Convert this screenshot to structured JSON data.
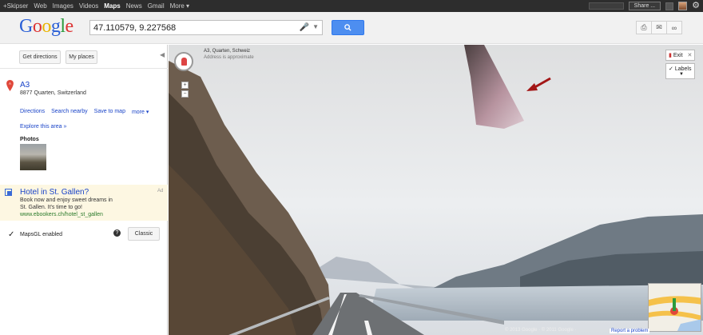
{
  "topbar": {
    "items": [
      "+Skipser",
      "Web",
      "Images",
      "Videos",
      "Maps",
      "News",
      "Gmail",
      "More ▾"
    ],
    "active": "Maps",
    "share_label": "Share ..."
  },
  "header": {
    "logo": "Google",
    "search_value": "47.110579, 9.227568",
    "search_button_icon": "search-icon",
    "tools": [
      "print-icon",
      "email-icon",
      "link-icon"
    ]
  },
  "left": {
    "get_directions": "Get directions",
    "my_places": "My places",
    "place": {
      "title": "A3",
      "address": "8877 Quarten, Switzerland",
      "links": [
        "Directions",
        "Search nearby",
        "Save to map",
        "more ▾"
      ],
      "explore": "Explore this area »",
      "photos_label": "Photos"
    },
    "ad": {
      "title": "Hotel in St. Gallen?",
      "line1": "Book now and enjoy sweet dreams in",
      "line2": "St. Gallen. It's time to go!",
      "url": "www.ebookers.ch/hotel_st_gallen",
      "badge": "Ad"
    },
    "mapsgl": {
      "label": "MapsGL enabled",
      "classic_button": "Classic"
    }
  },
  "streetview": {
    "location": "A3, Quarten, Schweiz",
    "location_sub": "Address is approximate",
    "exit_label": "Exit",
    "labels_label": "Labels",
    "copyright": "© 2013 Google · © 2011 Google ·",
    "report": "Report a problem"
  }
}
